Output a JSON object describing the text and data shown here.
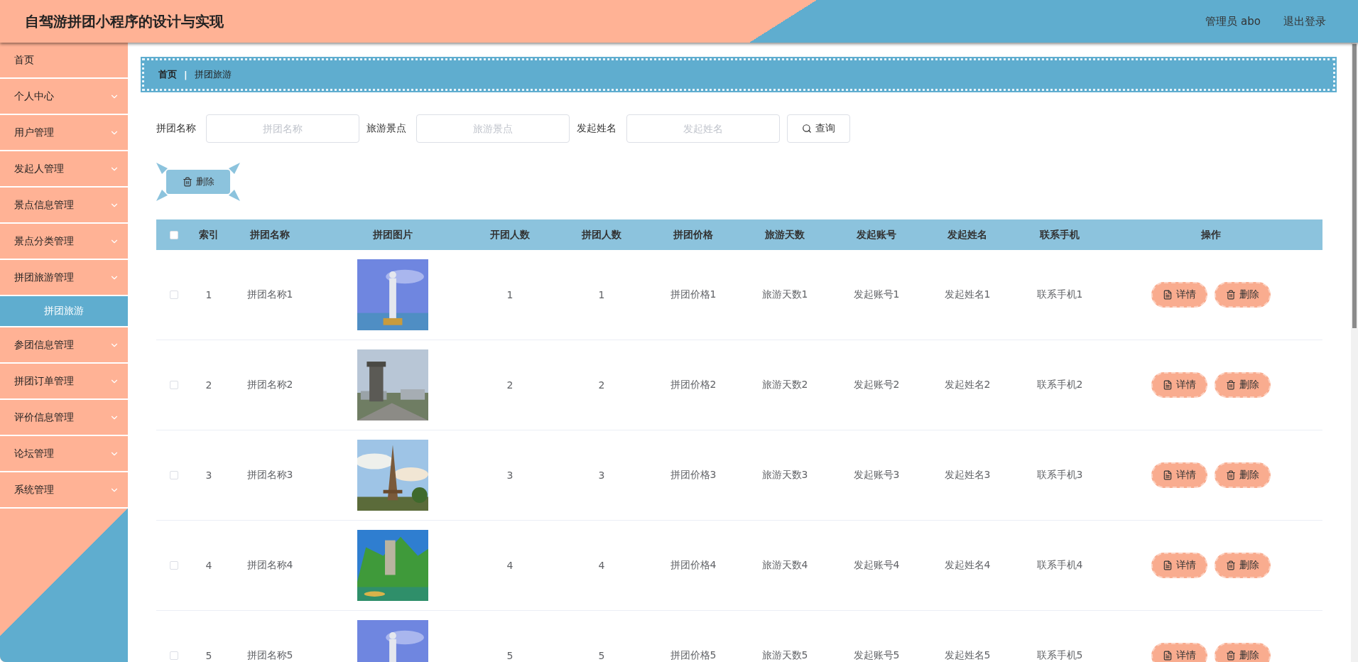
{
  "header": {
    "title": "自驾游拼团小程序的设计与实现",
    "user": "管理员 abo",
    "logout": "退出登录"
  },
  "sidebar": {
    "items": [
      {
        "label": "首页",
        "kind": "link"
      },
      {
        "label": "个人中心",
        "kind": "submenu"
      },
      {
        "label": "用户管理",
        "kind": "submenu"
      },
      {
        "label": "发起人管理",
        "kind": "submenu"
      },
      {
        "label": "景点信息管理",
        "kind": "submenu"
      },
      {
        "label": "景点分类管理",
        "kind": "submenu"
      },
      {
        "label": "拼团旅游管理",
        "kind": "submenu",
        "children": [
          {
            "label": "拼团旅游",
            "selected": true
          }
        ]
      },
      {
        "label": "参团信息管理",
        "kind": "submenu"
      },
      {
        "label": "拼团订单管理",
        "kind": "submenu"
      },
      {
        "label": "评价信息管理",
        "kind": "submenu"
      },
      {
        "label": "论坛管理",
        "kind": "submenu"
      },
      {
        "label": "系统管理",
        "kind": "submenu"
      }
    ]
  },
  "breadcrumb": {
    "items": [
      "首页",
      "拼团旅游"
    ],
    "separator": "|"
  },
  "search": {
    "fields": [
      {
        "label": "拼团名称",
        "placeholder": "拼团名称"
      },
      {
        "label": "旅游景点",
        "placeholder": "旅游景点"
      },
      {
        "label": "发起姓名",
        "placeholder": "发起姓名"
      }
    ],
    "button": "查询"
  },
  "toolbar": {
    "delete_button": "删除"
  },
  "table": {
    "select_all_checked": false,
    "columns": [
      "索引",
      "拼团名称",
      "拼团图片",
      "开团人数",
      "拼团人数",
      "拼团价格",
      "旅游天数",
      "发起账号",
      "发起姓名",
      "联系手机",
      "操作"
    ],
    "rows": [
      {
        "checked": false,
        "index": "1",
        "name": "拼团名称1",
        "image": {
          "kind": "picture"
        },
        "open_count": "1",
        "group_count": "1",
        "price": "拼团价格1",
        "days": "旅游天数1",
        "account": "发起账号1",
        "initiator": "发起姓名1",
        "phone": "联系手机1",
        "actions": [
          {
            "label": "详情",
            "kind": "detail"
          },
          {
            "label": "删除",
            "kind": "delete"
          }
        ]
      },
      {
        "checked": false,
        "index": "2",
        "name": "拼团名称2",
        "image": {
          "kind": "picture"
        },
        "open_count": "2",
        "group_count": "2",
        "price": "拼团价格2",
        "days": "旅游天数2",
        "account": "发起账号2",
        "initiator": "发起姓名2",
        "phone": "联系手机2",
        "actions": [
          {
            "label": "详情",
            "kind": "detail"
          },
          {
            "label": "删除",
            "kind": "delete"
          }
        ]
      },
      {
        "checked": false,
        "index": "3",
        "name": "拼团名称3",
        "image": {
          "kind": "picture"
        },
        "open_count": "3",
        "group_count": "3",
        "price": "拼团价格3",
        "days": "旅游天数3",
        "account": "发起账号3",
        "initiator": "发起姓名3",
        "phone": "联系手机3",
        "actions": [
          {
            "label": "详情",
            "kind": "detail"
          },
          {
            "label": "删除",
            "kind": "delete"
          }
        ]
      },
      {
        "checked": false,
        "index": "4",
        "name": "拼团名称4",
        "image": {
          "kind": "picture"
        },
        "open_count": "4",
        "group_count": "4",
        "price": "拼团价格4",
        "days": "旅游天数4",
        "account": "发起账号4",
        "initiator": "发起姓名4",
        "phone": "联系手机4",
        "actions": [
          {
            "label": "详情",
            "kind": "detail"
          },
          {
            "label": "删除",
            "kind": "delete"
          }
        ]
      },
      {
        "checked": false,
        "index": "5",
        "name": "拼团名称5",
        "image": {
          "kind": "picture"
        },
        "open_count": "5",
        "group_count": "5",
        "price": "拼团价格5",
        "days": "旅游天数5",
        "account": "发起账号5",
        "initiator": "发起姓名5",
        "phone": "联系手机5",
        "actions": [
          {
            "label": "详情",
            "kind": "detail"
          },
          {
            "label": "删除",
            "kind": "delete"
          }
        ]
      }
    ]
  }
}
